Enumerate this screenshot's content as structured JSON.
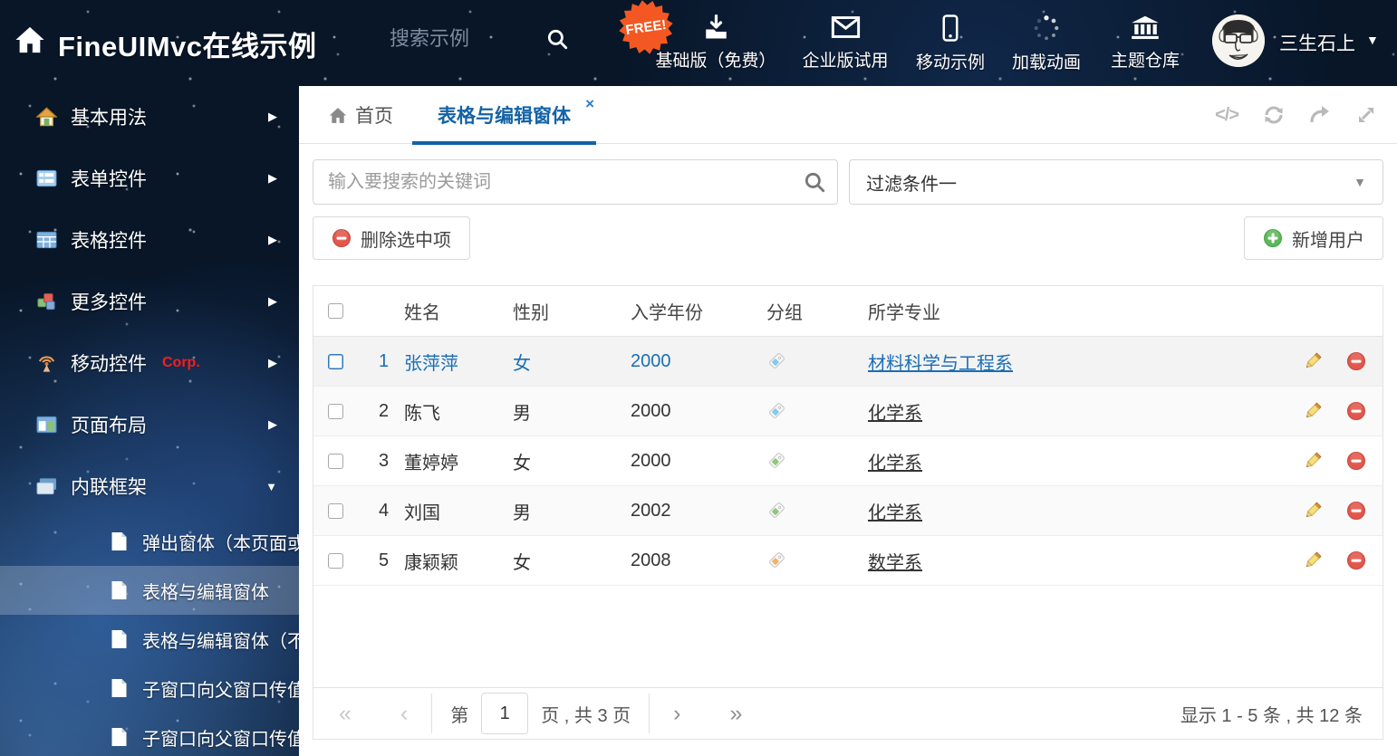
{
  "header": {
    "title": "FineUIMvc在线示例",
    "search_placeholder": "搜索示例",
    "free_badge": "FREE!",
    "nav": [
      {
        "icon": "download-icon",
        "label": "基础版（免费）"
      },
      {
        "icon": "envelope-icon",
        "label": "企业版试用"
      },
      {
        "icon": "phone-icon",
        "label": "移动示例"
      },
      {
        "icon": "spinner-icon",
        "label": "加载动画"
      },
      {
        "icon": "bank-icon",
        "label": "主题仓库"
      }
    ],
    "username": "三生石上",
    "caret": "▼"
  },
  "sidebar": {
    "items": [
      {
        "label": "基本用法",
        "arrow": "▶"
      },
      {
        "label": "表单控件",
        "arrow": "▶"
      },
      {
        "label": "表格控件",
        "arrow": "▶"
      },
      {
        "label": "更多控件",
        "arrow": "▶"
      },
      {
        "label": "移动控件",
        "badge": "Corp.",
        "arrow": "▶"
      },
      {
        "label": "页面布局",
        "arrow": "▶"
      },
      {
        "label": "内联框架",
        "arrow": "▼"
      }
    ],
    "subitems": [
      {
        "label": "弹出窗体（本页面或..."
      },
      {
        "label": "表格与编辑窗体",
        "selected": true
      },
      {
        "label": "表格与编辑窗体（不..."
      },
      {
        "label": "子窗口向父窗口传值"
      },
      {
        "label": "子窗口向父窗口传值..."
      }
    ]
  },
  "tabs": {
    "home": "首页",
    "active": "表格与编辑窗体",
    "close": "×"
  },
  "tools": {
    "code": "</>"
  },
  "filters": {
    "search_placeholder": "输入要搜索的关键词",
    "filter_value": "过滤条件一",
    "caret": "▼"
  },
  "toolbar": {
    "delete_label": "删除选中项",
    "add_label": "新增用户"
  },
  "table": {
    "headers": [
      "姓名",
      "性别",
      "入学年份",
      "分组",
      "所学专业"
    ],
    "rows": [
      {
        "num": "1",
        "name": "张萍萍",
        "gender": "女",
        "year": "2000",
        "tag_color": "#85c8f2",
        "major": "材料科学与工程系",
        "selected": true
      },
      {
        "num": "2",
        "name": "陈飞",
        "gender": "男",
        "year": "2000",
        "tag_color": "#85c8f2",
        "major": "化学系"
      },
      {
        "num": "3",
        "name": "董婷婷",
        "gender": "女",
        "year": "2000",
        "tag_color": "#8fc878",
        "major": "化学系"
      },
      {
        "num": "4",
        "name": "刘国",
        "gender": "男",
        "year": "2002",
        "tag_color": "#8fc878",
        "major": "化学系"
      },
      {
        "num": "5",
        "name": "康颖颖",
        "gender": "女",
        "year": "2008",
        "tag_color": "#f6b26b",
        "major": "数学系"
      }
    ]
  },
  "pagination": {
    "first": "«",
    "prev": "‹",
    "next": "›",
    "last": "»",
    "page_label_pre": "第",
    "page_value": "1",
    "page_label_post": "页 , 共 3 页",
    "summary": "显示 1 - 5 条 , 共 12 条"
  },
  "colors": {
    "accent_blue": "#1462a5",
    "selected_text": "#1a6eb5",
    "delete_red": "#e2574c",
    "add_green": "#5cb85c",
    "header_bg": "#081628"
  }
}
